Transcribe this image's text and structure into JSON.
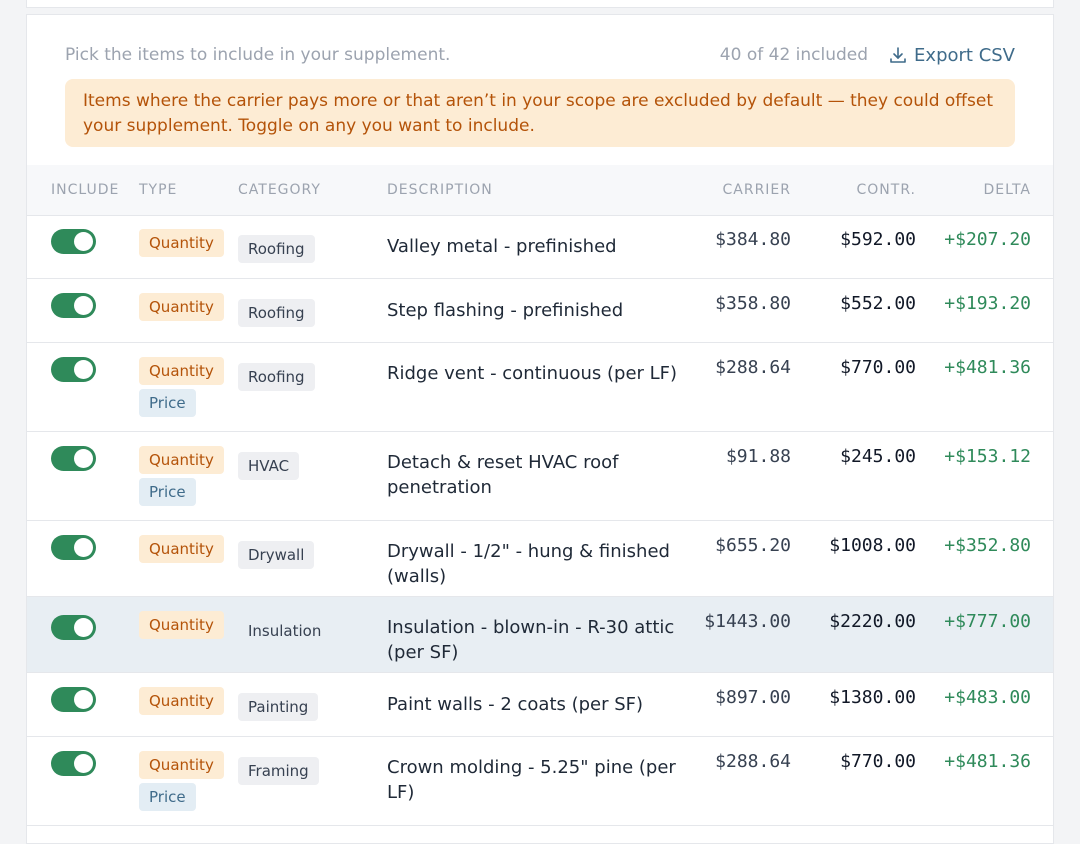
{
  "header": {
    "subtitle": "Pick the items to include in your supplement.",
    "count": "40 of 42 included",
    "export_label": "Export CSV"
  },
  "banner": {
    "text": "Items where the carrier pays more or that aren’t in your scope are excluded by default — they could offset your supplement. Toggle on any you want to include."
  },
  "columns": {
    "include": "INCLUDE",
    "type": "TYPE",
    "category": "CATEGORY",
    "description": "DESCRIPTION",
    "carrier": "CARRIER",
    "contr": "CONTR.",
    "delta": "DELTA"
  },
  "rows": [
    {
      "included": true,
      "types": [
        "Quantity"
      ],
      "category": "Roofing",
      "description": "Valley metal - prefinished",
      "carrier": "$384.80",
      "contr": "$592.00",
      "delta": "+$207.20"
    },
    {
      "included": true,
      "types": [
        "Quantity"
      ],
      "category": "Roofing",
      "description": "Step flashing - prefinished",
      "carrier": "$358.80",
      "contr": "$552.00",
      "delta": "+$193.20"
    },
    {
      "included": true,
      "types": [
        "Quantity",
        "Price"
      ],
      "category": "Roofing",
      "description": "Ridge vent - continuous (per LF)",
      "carrier": "$288.64",
      "contr": "$770.00",
      "delta": "+$481.36"
    },
    {
      "included": true,
      "types": [
        "Quantity",
        "Price"
      ],
      "category": "HVAC",
      "description": "Detach & reset HVAC roof penetration",
      "carrier": "$91.88",
      "contr": "$245.00",
      "delta": "+$153.12"
    },
    {
      "included": true,
      "types": [
        "Quantity"
      ],
      "category": "Drywall",
      "description": "Drywall - 1/2\" - hung & finished (walls)",
      "carrier": "$655.20",
      "contr": "$1008.00",
      "delta": "+$352.80"
    },
    {
      "included": true,
      "types": [
        "Quantity"
      ],
      "category": "Insulation",
      "description": "Insulation - blown-in - R-30 attic (per SF)",
      "carrier": "$1443.00",
      "contr": "$2220.00",
      "delta": "+$777.00",
      "highlighted": true
    },
    {
      "included": true,
      "types": [
        "Quantity"
      ],
      "category": "Painting",
      "description": "Paint walls - 2 coats (per SF)",
      "carrier": "$897.00",
      "contr": "$1380.00",
      "delta": "+$483.00"
    },
    {
      "included": true,
      "types": [
        "Quantity",
        "Price"
      ],
      "category": "Framing",
      "description": "Crown molding - 5.25\" pine (per LF)",
      "carrier": "$288.64",
      "contr": "$770.00",
      "delta": "+$481.36"
    }
  ]
}
